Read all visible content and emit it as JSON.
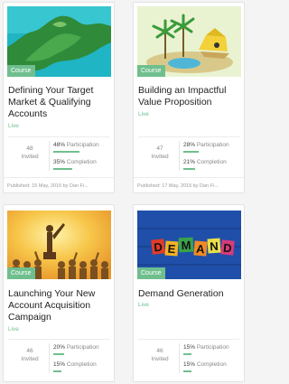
{
  "cards": [
    {
      "badge": "Course",
      "title": "Defining Your Target Market & Qualifying Accounts",
      "status": "Live",
      "invited_count": "48",
      "invited_label": "Invited",
      "participation_value": "48%",
      "participation_label": "Participation",
      "participation_fraction": 0.48,
      "completion_value": "35%",
      "completion_label": "Completion",
      "completion_fraction": 0.35,
      "published": "Published: 15 May, 2015 by Dan Fi..."
    },
    {
      "badge": "Course",
      "title": "Building an Impactful Value Proposition",
      "status": "Live",
      "invited_count": "47",
      "invited_label": "Invited",
      "participation_value": "28%",
      "participation_label": "Participation",
      "participation_fraction": 0.28,
      "completion_value": "21%",
      "completion_label": "Completion",
      "completion_fraction": 0.21,
      "published": "Published: 17 May, 2015 by Dan Fi..."
    },
    {
      "badge": "Course",
      "title": "Launching Your New Account Acquisition Campaign",
      "status": "Live",
      "invited_count": "46",
      "invited_label": "Invited",
      "participation_value": "20%",
      "participation_label": "Participation",
      "participation_fraction": 0.2,
      "completion_value": "15%",
      "completion_label": "Completion",
      "completion_fraction": 0.15
    },
    {
      "badge": "Course",
      "title": "Demand Generation",
      "status": "Live",
      "invited_count": "46",
      "invited_label": "Invited",
      "participation_value": "15%",
      "participation_label": "Participation",
      "participation_fraction": 0.15,
      "completion_value": "15%",
      "completion_label": "Completion",
      "completion_fraction": 0.15
    }
  ],
  "colors": {
    "accent": "#6fbf8e",
    "card_bg": "#ffffff",
    "page_bg": "#f4f4f4"
  }
}
